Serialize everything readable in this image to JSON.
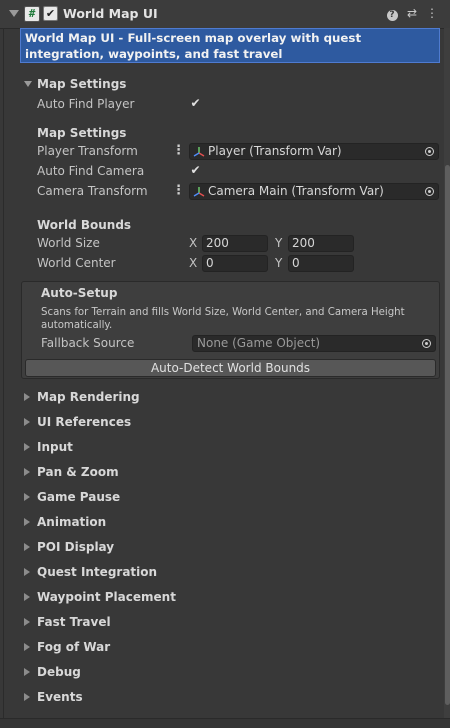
{
  "header": {
    "title": "World Map UI",
    "script_icon_glyph": "#",
    "enabled_glyph": "✔",
    "help_glyph": "?",
    "preset_glyph": "⇄",
    "menu_glyph": "⋮"
  },
  "description": "World Map UI - Full-screen map overlay with quest integration, waypoints, and fast travel",
  "map_settings_foldout": {
    "label": "Map Settings",
    "auto_find_player_label": "Auto Find Player",
    "auto_find_player": true
  },
  "map_settings": {
    "header": "Map Settings",
    "player_transform_label": "Player Transform",
    "player_transform_value": "Player (Transform Var)",
    "auto_find_camera_label": "Auto Find Camera",
    "auto_find_camera": true,
    "camera_transform_label": "Camera Transform",
    "camera_transform_value": "Camera Main (Transform Var)",
    "dots_glyph": "⋮",
    "check_glyph": "✔"
  },
  "world_bounds": {
    "header": "World Bounds",
    "world_size_label": "World Size",
    "world_size_x": "200",
    "world_size_y": "200",
    "world_center_label": "World Center",
    "world_center_x": "0",
    "world_center_y": "0",
    "x_label": "X",
    "y_label": "Y"
  },
  "auto_setup": {
    "header": "Auto-Setup",
    "help_text": "Scans for Terrain and fills World Size, World Center, and Camera Height automatically.",
    "fallback_label": "Fallback Source",
    "fallback_value": "None (Game Object)",
    "button_label": "Auto-Detect World Bounds"
  },
  "sections": [
    "Map Rendering",
    "UI References",
    "Input",
    "Pan & Zoom",
    "Game Pause",
    "Animation",
    "POI Display",
    "Quest Integration",
    "Waypoint Placement",
    "Fast Travel",
    "Fog of War",
    "Debug",
    "Events"
  ],
  "colors": {
    "background": "#383838",
    "description_bg": "#2e5aa0",
    "field_bg": "#2a2a2a",
    "button_bg": "#575757"
  }
}
